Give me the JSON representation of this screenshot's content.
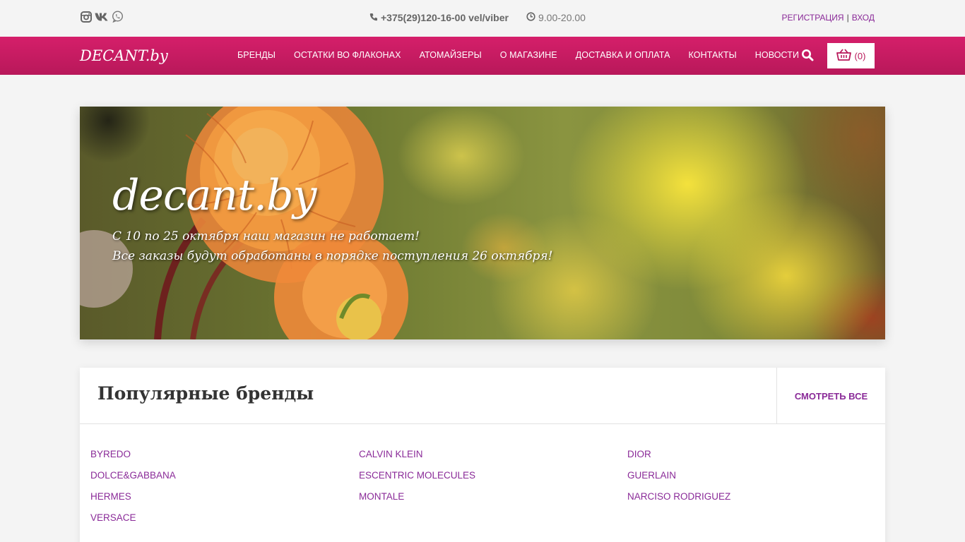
{
  "topbar": {
    "social_icons": [
      "instagram-icon",
      "vk-icon",
      "viber-icon"
    ],
    "phone": "+375(29)120-16-00 vel/viber",
    "hours": "9.00-20.00",
    "register_label": "Регистрация",
    "separator": "|",
    "login_label": "Вход"
  },
  "header": {
    "logo": "DECANT.by",
    "menu": [
      {
        "label": "БРЕНДЫ"
      },
      {
        "label": "ОСТАТКИ ВО ФЛАКОНАХ"
      },
      {
        "label": "АТОМАЙЗЕРЫ"
      },
      {
        "label": "О МАГАЗИНЕ"
      },
      {
        "label": "ДОСТАВКА И ОПЛАТА"
      },
      {
        "label": "КОНТАКТЫ"
      },
      {
        "label": "НОВОСТИ"
      }
    ],
    "cart_count": "(0)",
    "accent_color": "#c81c63"
  },
  "hero": {
    "title": "decant.by",
    "line1": "С 10 по 25 октября наш магазин не работает!",
    "line2": "Все заказы будут обработаны в порядке поступления 26 октября!"
  },
  "brands": {
    "title": "Популярные бренды",
    "view_all": "СМОТРЕТЬ ВСЕ",
    "link_color": "#8a2a98",
    "items": [
      "BYREDO",
      "CALVIN KLEIN",
      "DIOR",
      "DOLCE&GABBANA",
      "ESCENTRIC MOLECULES",
      "GUERLAIN",
      "HERMES",
      "MONTALE",
      "NARCISO RODRIGUEZ",
      "VERSACE"
    ]
  }
}
